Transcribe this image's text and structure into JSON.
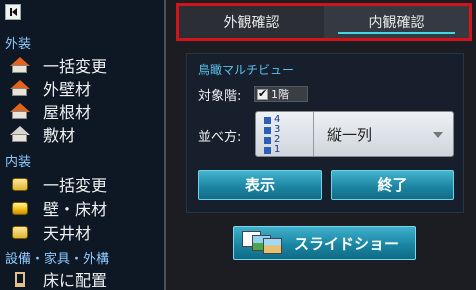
{
  "sidebar": {
    "exterior": {
      "header": "外装",
      "items": [
        {
          "label": "一括変更",
          "icon": "house-orange-roof-icon"
        },
        {
          "label": "外壁材",
          "icon": "house-orange-roof-icon"
        },
        {
          "label": "屋根材",
          "icon": "house-orange-roof-icon"
        },
        {
          "label": "敷材",
          "icon": "house-white-roof-icon"
        }
      ]
    },
    "interior": {
      "header": "内装",
      "items": [
        {
          "label": "一括変更",
          "icon": "yellow-cube-icon"
        },
        {
          "label": "壁・床材",
          "icon": "yellow-cube-icon"
        },
        {
          "label": "天井材",
          "icon": "yellow-cube-icon"
        }
      ]
    },
    "equipment": {
      "header": "設備・家具・外構",
      "items": [
        {
          "label": "床に配置",
          "icon": "chair-icon"
        }
      ]
    }
  },
  "tabs": [
    {
      "label": "外観確認",
      "active": false
    },
    {
      "label": "内観確認",
      "active": true
    }
  ],
  "panel": {
    "title": "鳥瞰マルチビュー",
    "floor_label": "対象階:",
    "floor_value": "1階",
    "floor_checked": true,
    "arrange_label": "並べ方:",
    "arrange_value": "縦一列",
    "floor_stack": [
      "4",
      "3",
      "2",
      "1"
    ],
    "show_button": "表示",
    "end_button": "終了"
  },
  "slideshow_label": "スライドショー",
  "colors": {
    "tab_border": "#d3131b",
    "accent": "#40d8e6",
    "button": "#1d86a3",
    "section_header": "#8fc9ff"
  }
}
